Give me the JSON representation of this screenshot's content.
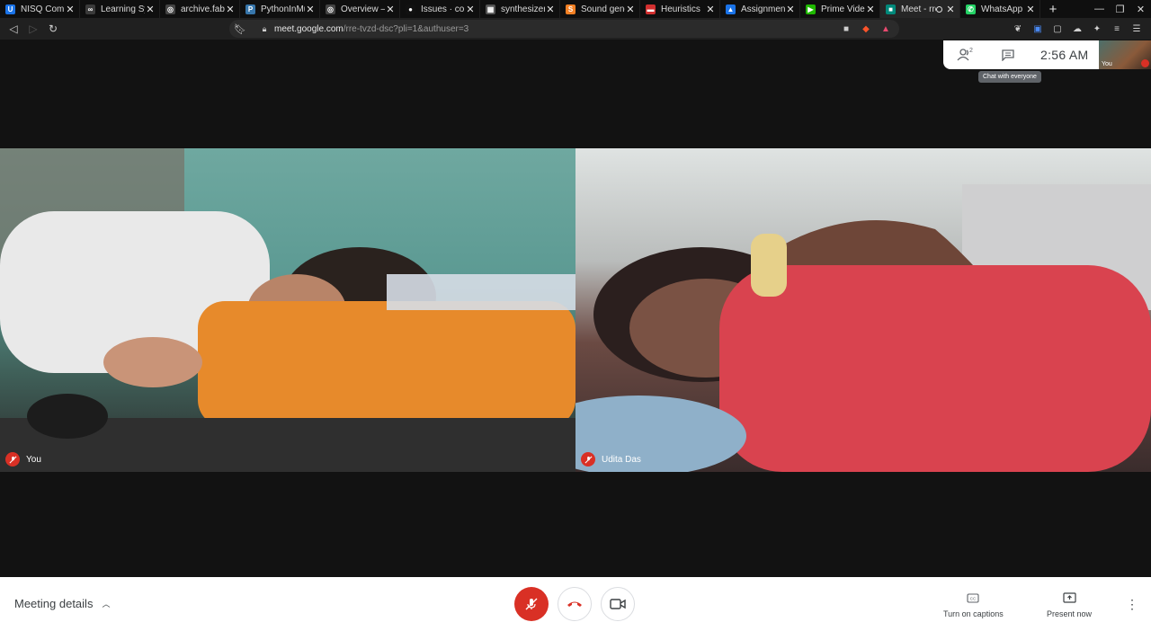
{
  "browser": {
    "tabs": [
      {
        "title": "NISQ Compu",
        "favicon_color": "#1a73e8",
        "favicon_text": "U",
        "icon": "nisq-favicon-icon"
      },
      {
        "title": "Learning Syn",
        "favicon_color": "#3a3a3a",
        "favicon_text": "∞",
        "icon": "learning-favicon-icon"
      },
      {
        "title": "archive.fabac",
        "favicon_color": "#444444",
        "favicon_text": "◎",
        "icon": "globe-favicon-icon"
      },
      {
        "title": "PythonInMu",
        "favicon_color": "#3776ab",
        "favicon_text": "P",
        "icon": "python-favicon-icon"
      },
      {
        "title": "Overview — ",
        "favicon_color": "#444444",
        "favicon_text": "◎",
        "icon": "globe-favicon-icon"
      },
      {
        "title": "Issues · coun",
        "favicon_color": "#ffffff",
        "favicon_text": "●",
        "icon": "github-favicon-icon"
      },
      {
        "title": "synthesizer p",
        "favicon_color": "#555555",
        "favicon_text": "▦",
        "icon": "document-favicon-icon"
      },
      {
        "title": "Sound gener",
        "favicon_color": "#f48024",
        "favicon_text": "S",
        "icon": "stackoverflow-favicon-icon"
      },
      {
        "title": "Heuristics",
        "favicon_color": "#d32f2f",
        "favicon_text": "▬",
        "icon": "slides-favicon-icon"
      },
      {
        "title": "Assignment",
        "favicon_color": "#1a73e8",
        "favicon_text": "▲",
        "icon": "classroom-favicon-icon"
      },
      {
        "title": "Prime Video",
        "favicon_color": "#1fb800",
        "favicon_text": "▶",
        "icon": "prime-video-favicon-icon"
      },
      {
        "title": "Meet - rre",
        "favicon_color": "#00897b",
        "favicon_text": "■",
        "icon": "meet-favicon-icon",
        "active": true,
        "recording": true
      },
      {
        "title": "WhatsApp",
        "favicon_color": "#25d366",
        "favicon_text": "✆",
        "icon": "whatsapp-favicon-icon"
      }
    ],
    "url_host": "meet.google.com",
    "url_path": "/rre-tvzd-dsc?pli=1&authuser=3"
  },
  "meet": {
    "people_count": "2",
    "clock": "2:56",
    "ampm": "AM",
    "tooltip": "Chat with everyone",
    "selfview_label": "You",
    "tiles": [
      {
        "name": "You"
      },
      {
        "name": "Udita Das"
      }
    ],
    "meeting_details": "Meeting details",
    "captions_label": "Turn on captions",
    "present_label": "Present now",
    "colors": {
      "mute_red": "#d93025",
      "text_dark": "#3c4043"
    }
  }
}
